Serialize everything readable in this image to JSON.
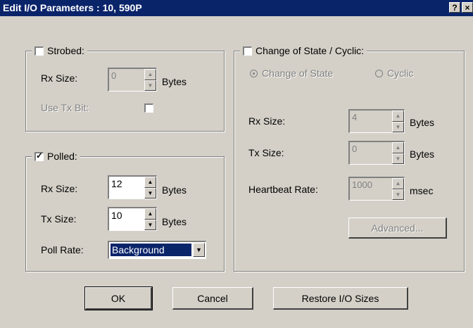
{
  "window": {
    "title": "Edit I/O Parameters : 10, 590P",
    "help_glyph": "?",
    "close_glyph": "×"
  },
  "strobed": {
    "checkbox_label": "Strobed:",
    "checked": false,
    "rx_size_label": "Rx Size:",
    "rx_size_value": "0",
    "rx_units": "Bytes",
    "use_tx_bit_label": "Use Tx Bit:",
    "use_tx_bit_checked": false
  },
  "polled": {
    "checkbox_label": "Polled:",
    "checked": true,
    "rx_size_label": "Rx Size:",
    "rx_size_value": "12",
    "rx_units": "Bytes",
    "tx_size_label": "Tx Size:",
    "tx_size_value": "10",
    "tx_units": "Bytes",
    "poll_rate_label": "Poll Rate:",
    "poll_rate_value": "Background"
  },
  "cos": {
    "checkbox_label": "Change of State / Cyclic:",
    "checked": false,
    "radio_change_label": "Change of State",
    "radio_cyclic_label": "Cyclic",
    "selected": "Change of State",
    "rx_size_label": "Rx Size:",
    "rx_size_value": "4",
    "rx_units": "Bytes",
    "tx_size_label": "Tx Size:",
    "tx_size_value": "0",
    "tx_units": "Bytes",
    "heartbeat_label": "Heartbeat Rate:",
    "heartbeat_value": "1000",
    "heartbeat_units": "msec",
    "advanced_label": "Advanced..."
  },
  "buttons": {
    "ok": "OK",
    "cancel": "Cancel",
    "restore": "Restore I/O Sizes"
  },
  "icons": {
    "spin_up": "▲",
    "spin_down": "▼",
    "dropdown": "▼"
  }
}
